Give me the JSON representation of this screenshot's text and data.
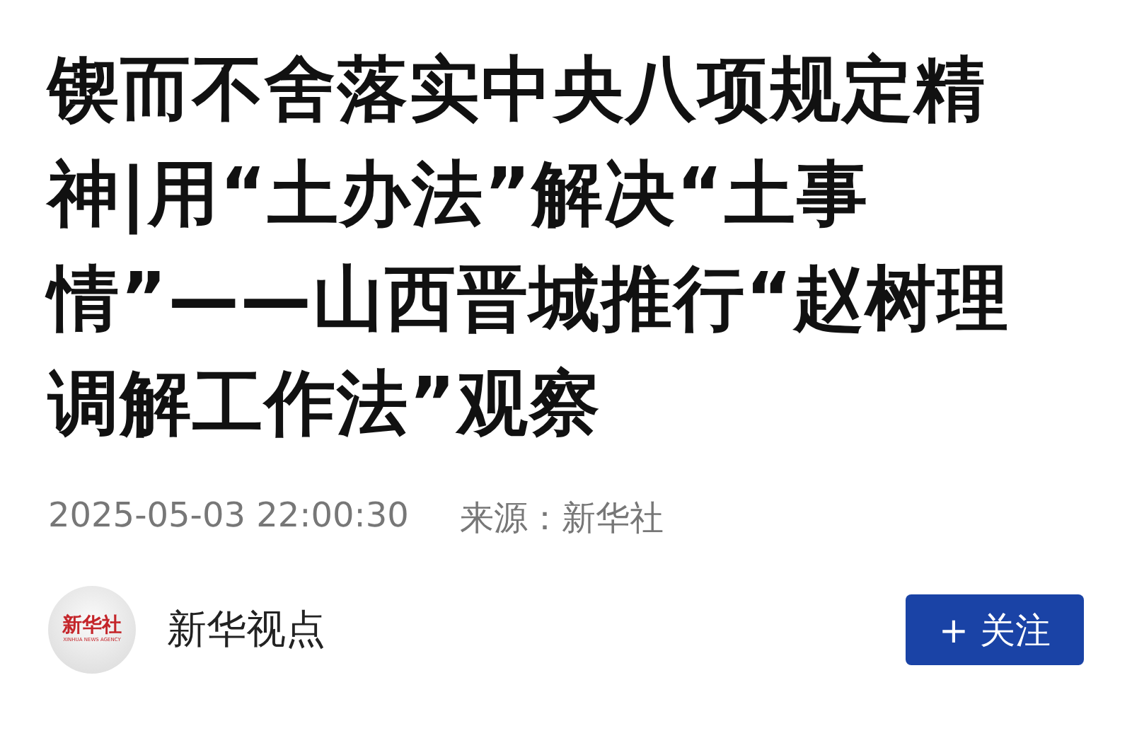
{
  "article": {
    "title": "锲而不舍落实中央八项规定精神|用“土办法”解决“土事情”——山西晋城推行“赵树理调解工作法”观察",
    "published": "2025-05-03 22:00:30",
    "source": "来源：新华社"
  },
  "author": {
    "logo": {
      "name": "新华社",
      "subtitle": "XINHUA NEWS AGENCY"
    },
    "name": "新华视点",
    "follow_button": "+ 关注"
  }
}
